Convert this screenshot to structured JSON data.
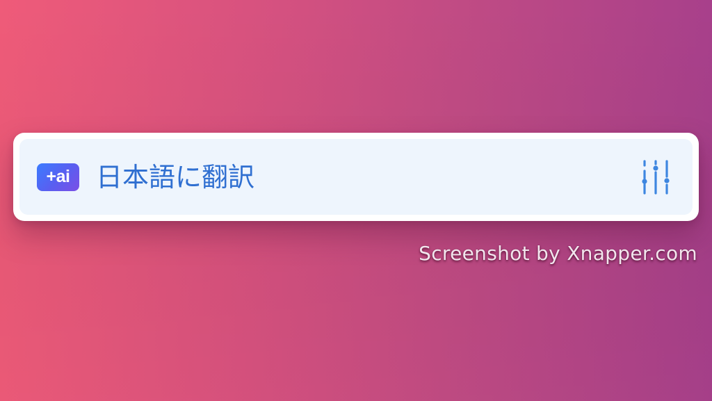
{
  "colors": {
    "background_left": "#ef5b79",
    "background_right": "#a8408b",
    "card": "#ffffff",
    "row": "#eef5fd",
    "accent": "#2f6fd1",
    "badge_start": "#3b7cff",
    "badge_end": "#7b4fe6"
  },
  "action": {
    "badge_text": "+ai",
    "label": "日本語に翻訳",
    "settings_icon": "sliders-icon"
  },
  "watermark": {
    "text": "Screenshot by Xnapper.com"
  }
}
